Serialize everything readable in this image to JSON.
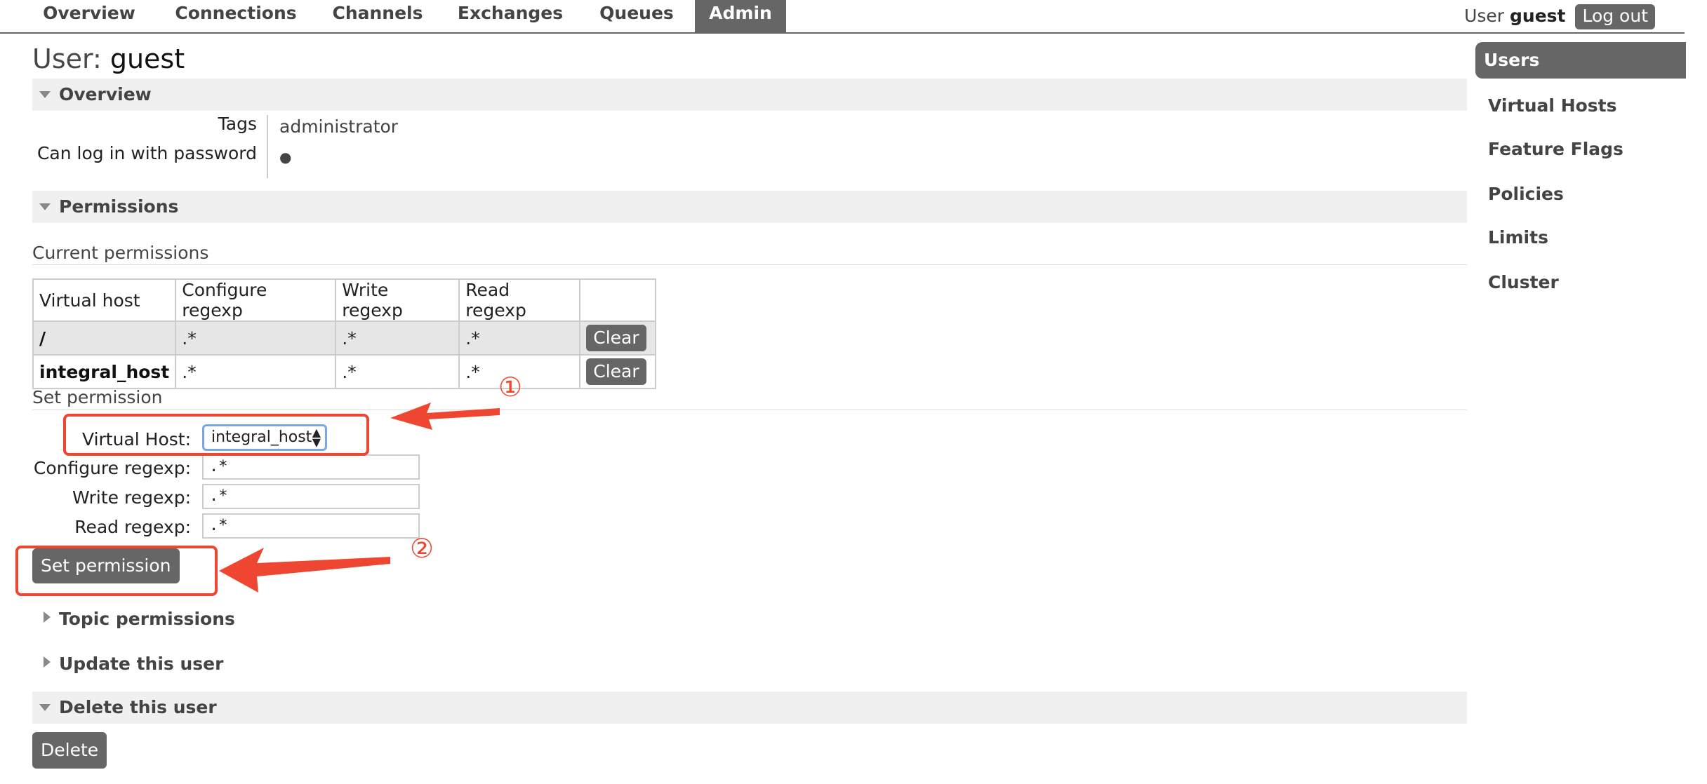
{
  "nav": {
    "tabs": [
      "Overview",
      "Connections",
      "Channels",
      "Exchanges",
      "Queues",
      "Admin"
    ],
    "active": "Admin"
  },
  "user_info": {
    "prefix": "User",
    "name": "guest",
    "logout_label": "Log out"
  },
  "sidebar": {
    "items": [
      "Users",
      "Virtual Hosts",
      "Feature Flags",
      "Policies",
      "Limits",
      "Cluster"
    ],
    "active": "Users"
  },
  "page": {
    "title_prefix": "User:",
    "title_name": "guest"
  },
  "overview": {
    "heading": "Overview",
    "tags_label": "Tags",
    "tags_value": "administrator",
    "login_label": "Can log in with password",
    "login_value": "●"
  },
  "permissions": {
    "heading": "Permissions",
    "current_heading": "Current permissions",
    "columns": [
      "Virtual host",
      "Configure regexp",
      "Write regexp",
      "Read regexp"
    ],
    "rows": [
      {
        "vhost": "/",
        "configure": ".*",
        "write": ".*",
        "read": ".*",
        "action": "Clear"
      },
      {
        "vhost": "integral_host",
        "configure": ".*",
        "write": ".*",
        "read": ".*",
        "action": "Clear"
      }
    ],
    "set_heading": "Set permission",
    "form": {
      "vhost_label": "Virtual Host:",
      "vhost_value": "integral_host",
      "configure_label": "Configure regexp:",
      "configure_value": ".*",
      "write_label": "Write regexp:",
      "write_value": ".*",
      "read_label": "Read regexp:",
      "read_value": ".*",
      "submit_label": "Set permission"
    }
  },
  "sections": {
    "topic": "Topic permissions",
    "update": "Update this user",
    "delete": "Delete this user",
    "delete_button": "Delete"
  },
  "annotations": {
    "marker_1": "①",
    "marker_2": "②",
    "color": "#ef4631"
  },
  "colors": {
    "nav_active_bg": "#666666",
    "section_bg": "#f0f0f0",
    "button_bg": "#666666"
  }
}
